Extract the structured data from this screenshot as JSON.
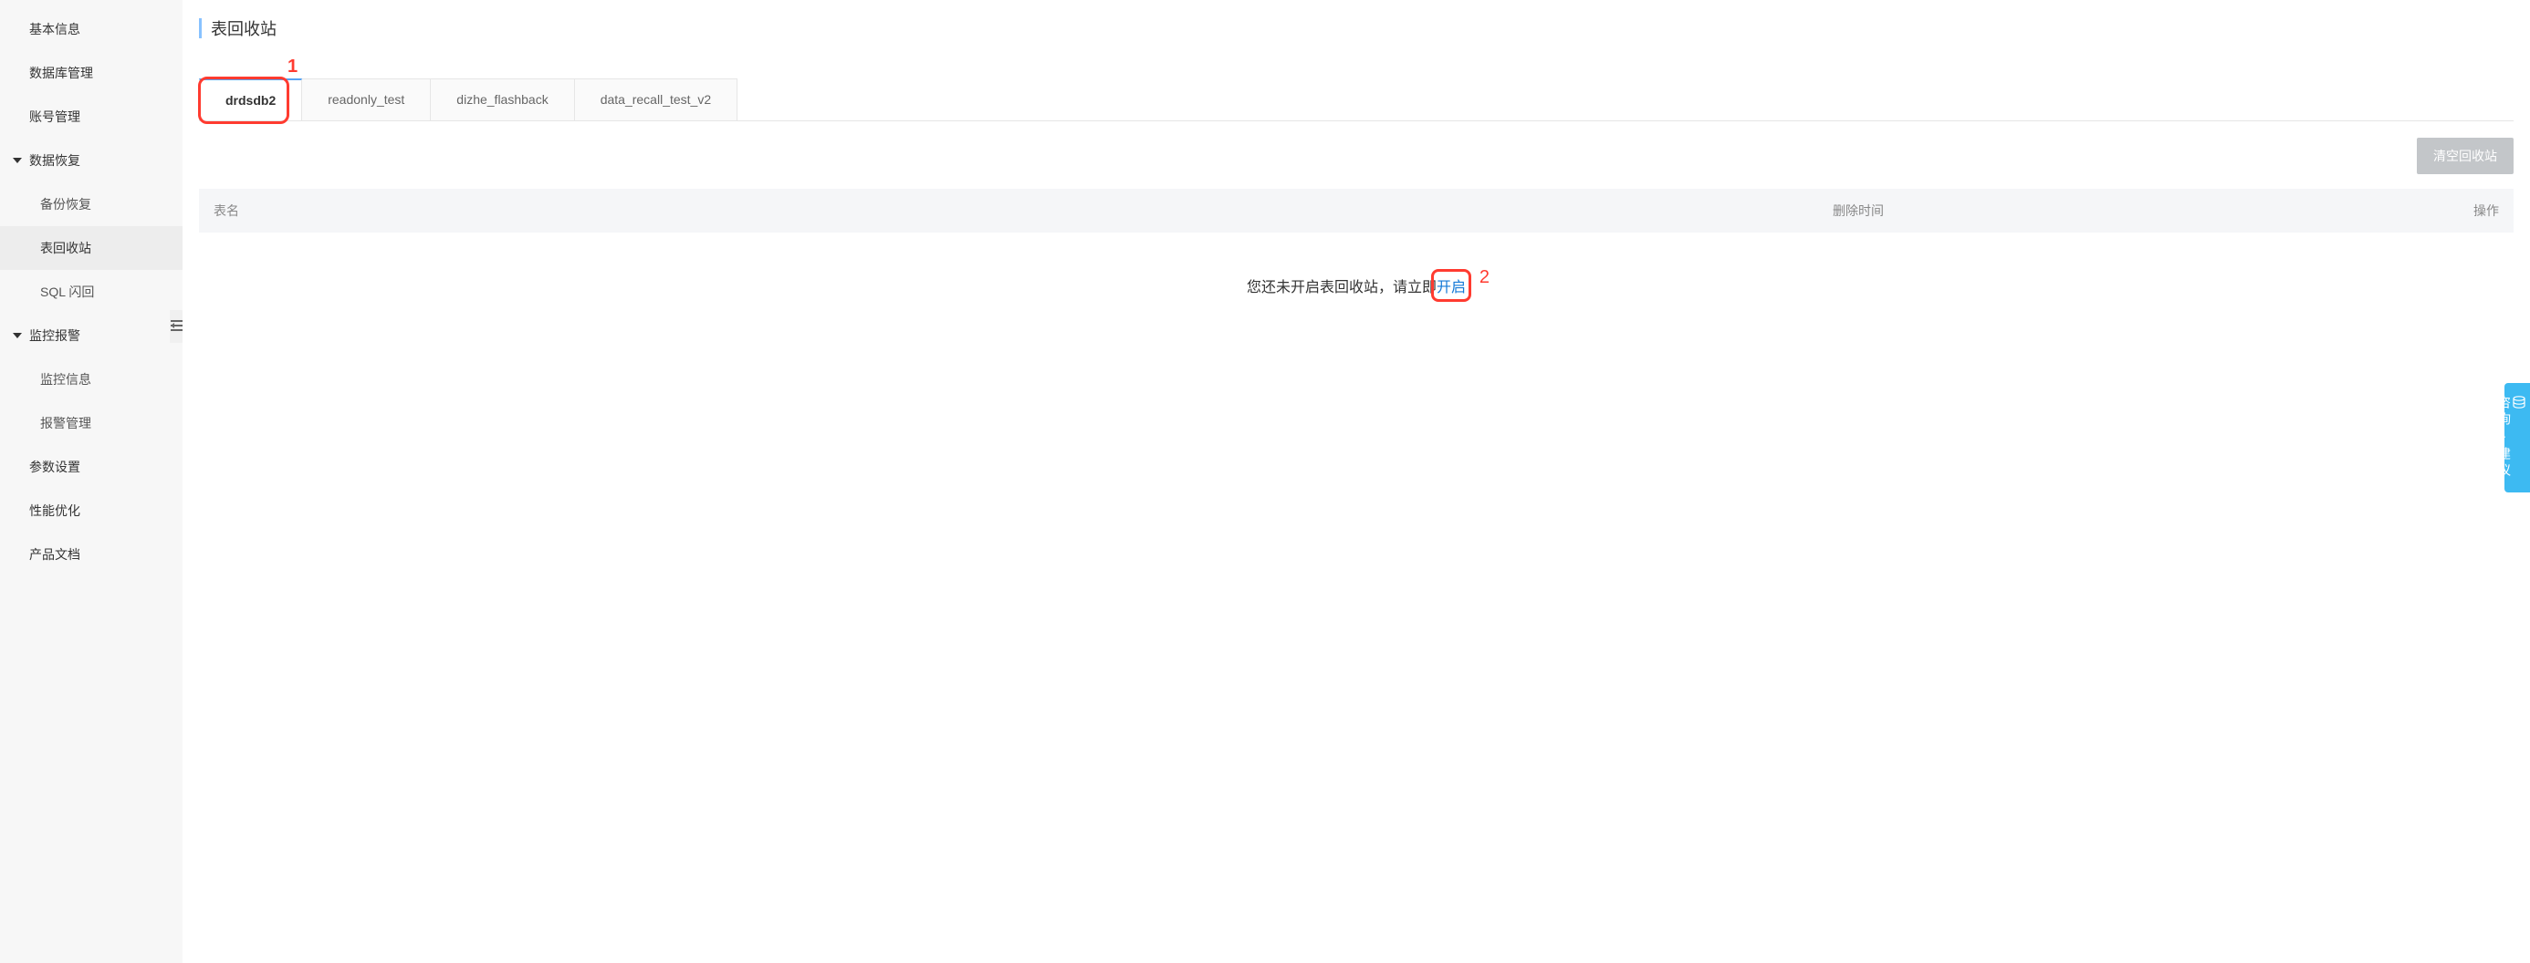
{
  "sidebar": {
    "items": [
      {
        "label": "基本信息",
        "type": "top"
      },
      {
        "label": "数据库管理",
        "type": "top"
      },
      {
        "label": "账号管理",
        "type": "top"
      },
      {
        "label": "数据恢复",
        "type": "group"
      },
      {
        "label": "备份恢复",
        "type": "sub"
      },
      {
        "label": "表回收站",
        "type": "sub",
        "active": true
      },
      {
        "label": "SQL 闪回",
        "type": "sub"
      },
      {
        "label": "监控报警",
        "type": "group"
      },
      {
        "label": "监控信息",
        "type": "sub"
      },
      {
        "label": "报警管理",
        "type": "sub"
      },
      {
        "label": "参数设置",
        "type": "top"
      },
      {
        "label": "性能优化",
        "type": "top"
      },
      {
        "label": "产品文档",
        "type": "top"
      }
    ]
  },
  "page": {
    "title": "表回收站"
  },
  "tabs": [
    {
      "label": "drdsdb2",
      "active": true
    },
    {
      "label": "readonly_test"
    },
    {
      "label": "dizhe_flashback"
    },
    {
      "label": "data_recall_test_v2"
    }
  ],
  "annotations": {
    "first": "1",
    "second": "2"
  },
  "actions": {
    "clear_label": "清空回收站"
  },
  "table": {
    "columns": {
      "name": "表名",
      "delete_time": "删除时间",
      "operation": "操作"
    },
    "empty_prefix": "您还未开启表回收站，请立即",
    "empty_link": "开启"
  },
  "feedback": {
    "label": "咨询·建议"
  }
}
